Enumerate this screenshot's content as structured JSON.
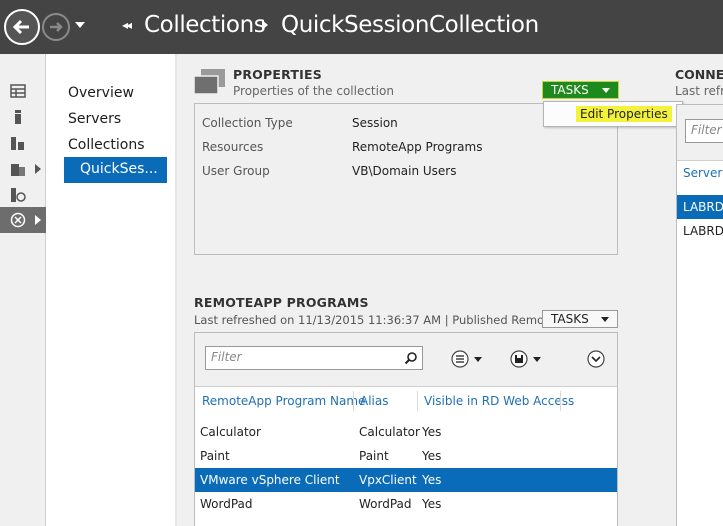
{
  "titlebar": {
    "breadcrumb_root": "Collections",
    "breadcrumb_current": "QuickSessionCollection"
  },
  "icon_strip": {
    "items": [
      {
        "icon": "dashboard-icon"
      },
      {
        "icon": "local-server-icon"
      },
      {
        "icon": "all-servers-icon"
      },
      {
        "icon": "file-storage-icon"
      },
      {
        "icon": "iis-icon"
      },
      {
        "icon": "remote-desktop-services-icon"
      }
    ]
  },
  "navpane": {
    "items": [
      "Overview",
      "Servers",
      "Collections",
      "QuickSes..."
    ],
    "selected": "QuickSes..."
  },
  "properties": {
    "title": "PROPERTIES",
    "subtitle": "Properties of the collection",
    "tasks_label": "TASKS",
    "menu_item": "Edit Properties",
    "rows": [
      {
        "label": "Collection Type",
        "value": "Session"
      },
      {
        "label": "Resources",
        "value": "RemoteApp Programs"
      },
      {
        "label": "User Group",
        "value": "VB\\Domain Users"
      }
    ]
  },
  "remoteapp": {
    "title": "REMOTEAPP PROGRAMS",
    "subtitle": "Last refreshed on 11/13/2015 11:36:37 AM | Published Remote...",
    "tasks_label": "TASKS",
    "filter_placeholder": "Filter",
    "columns": [
      "RemoteApp Program Name",
      "Alias",
      "Visible in RD Web Access"
    ],
    "rows": [
      {
        "name": "Calculator",
        "alias": "Calculator",
        "visible": "Yes"
      },
      {
        "name": "Paint",
        "alias": "Paint",
        "visible": "Yes"
      },
      {
        "name": "VMware vSphere Client",
        "alias": "VpxClient",
        "visible": "Yes"
      },
      {
        "name": "WordPad",
        "alias": "WordPad",
        "visible": "Yes"
      }
    ],
    "selected_row": 2
  },
  "connections": {
    "title": "CONNE",
    "subtitle": "Last refre",
    "filter_placeholder": "Filter",
    "column": "Server F",
    "rows": [
      "LABRDS",
      "LABRDS"
    ],
    "selected_row": 0
  },
  "colors": {
    "titlebar": "#444444",
    "accent_blue": "#0a6cb8",
    "tasks_green": "#1e8a1e",
    "highlight_yellow": "#f3f23a",
    "panel_gray": "#f0f0f0"
  }
}
